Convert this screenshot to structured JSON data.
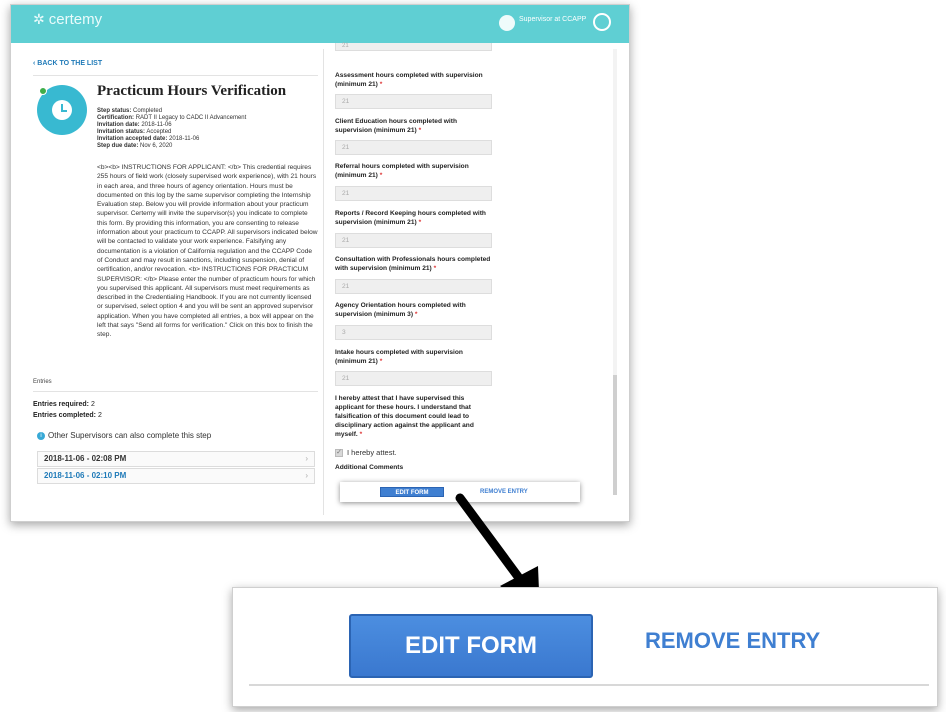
{
  "topbar": {
    "logo": "certemy",
    "supervisor_label": "Supervisor at CCAPP"
  },
  "left": {
    "back_link": "BACK TO THE LIST",
    "title": "Practicum Hours Verification",
    "meta": {
      "step_status_label": "Step status:",
      "step_status": "Completed",
      "certification_label": "Certification:",
      "certification": "RADT II Legacy to CADC II Advancement",
      "invitation_date_label": "Invitation date:",
      "invitation_date": "2018-11-06",
      "invitation_status_label": "Invitation status:",
      "invitation_status": "Accepted",
      "invitation_accepted_label": "Invitation accepted date:",
      "invitation_accepted": "2018-11-06",
      "step_due_label": "Step due date:",
      "step_due": "Nov 6, 2020"
    },
    "instructions": "<b><b> INSTRUCTIONS FOR APPLICANT: </b> This credential requires 255 hours of field work (closely supervised work experience), with 21 hours in each area, and three hours of agency orientation. Hours must be documented on this log by the same supervisor completing the Internship Evaluation step. Below you will provide information about your practicum supervisor. Certemy will invite the supervisor(s) you indicate to complete this form. By providing this information, you are consenting to release information about your practicum to CCAPP. All supervisors indicated below will be contacted to validate your work experience. Falsifying any documentation is a violation of California regulation and the CCAPP Code of Conduct and may result in sanctions, including suspension, denial of certification, and/or revocation. <b> INSTRUCTIONS FOR PRACTICUM SUPERVISOR: </b> Please enter the number of practicum hours for which you supervised this applicant. All supervisors must meet requirements as described in the Credentialing Handbook. If you are not currently licensed or supervised, select option 4 and you will be sent an approved supervisor application. When you have completed all entries, a box will appear on the left that says \"Send all forms for verification.\" Click on this box to finish the step.",
    "entries_label": "Entries",
    "entries_required_label": "Entries required:",
    "entries_required": "2",
    "entries_completed_label": "Entries completed:",
    "entries_completed": "2",
    "others_note": "Other Supervisors can also complete this step",
    "entries": [
      {
        "label": "2018-11-06 - 02:08 PM"
      },
      {
        "label": "2018-11-06 - 02:10 PM"
      }
    ]
  },
  "form": {
    "top_value": "21",
    "questions": [
      {
        "label": "Assessment hours completed with supervision (minimum 21)",
        "value": "21"
      },
      {
        "label": "Client Education hours completed with supervision (minimum 21)",
        "value": "21"
      },
      {
        "label": "Referral hours completed with supervision (minimum 21)",
        "value": "21"
      },
      {
        "label": "Reports / Record Keeping hours completed with supervision (minimum 21)",
        "value": "21"
      },
      {
        "label": "Consultation with Professionals hours completed with supervision (minimum 21)",
        "value": "21"
      },
      {
        "label": "Agency Orientation hours completed with supervision (minimum 3)",
        "value": "3"
      },
      {
        "label": "Intake hours completed with supervision (minimum 21)",
        "value": "21"
      }
    ],
    "attest_text": "I hereby attest that I have supervised this applicant for these hours. I understand that falsification of this document could lead to disciplinary action against the applicant and myself.",
    "attest_checkbox": "I hereby attest.",
    "additional_comments": "Additional Comments",
    "required_mark": "*"
  },
  "popup": {
    "edit_label": "EDIT FORM",
    "remove_label": "REMOVE ENTRY"
  },
  "zoom": {
    "edit_label": "EDIT FORM",
    "remove_label": "REMOVE ENTRY"
  }
}
